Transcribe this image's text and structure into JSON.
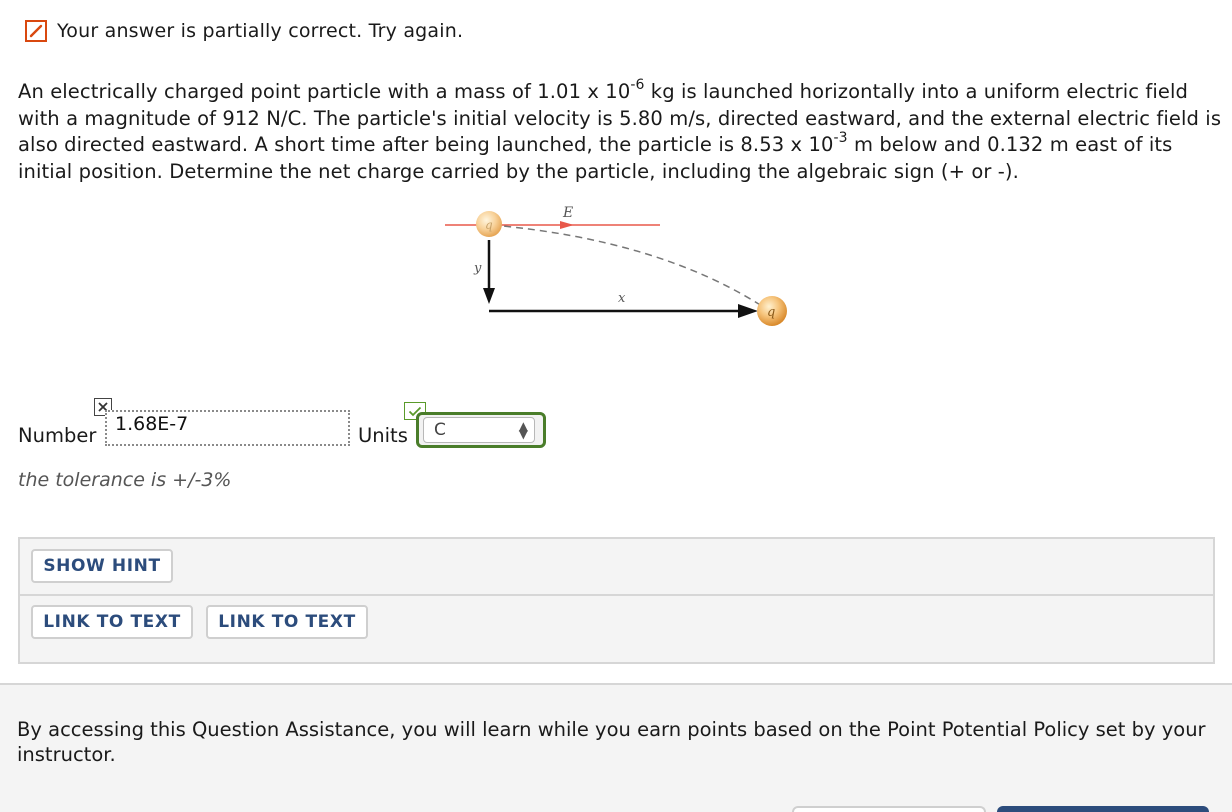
{
  "status": {
    "message": "Your answer is partially correct.  Try again."
  },
  "question": {
    "part1": "An electrically charged point particle with a mass of 1.01 x 10",
    "exp1": "-6",
    "part2": " kg is launched horizontally into a uniform electric field with a magnitude of 912 N/C. The particle's initial velocity is 5.80 m/s, directed eastward, and the external electric field is also directed eastward. A short time after being launched, the particle is 8.53 x 10",
    "exp2": "-3",
    "part3": " m below and 0.132 m east of its initial position. Determine the net charge carried by the particle, including the algebraic sign (+ or -)."
  },
  "figure": {
    "field_label": "E",
    "y_label": "y",
    "x_label": "x",
    "charge_label": "q"
  },
  "answer": {
    "number_label": "Number",
    "number_value": "1.68E-7",
    "units_label": "Units",
    "units_value": "C",
    "tolerance": "the tolerance is +/-3%"
  },
  "hints": {
    "show_hint": "SHOW HINT",
    "link_to_text_1": "LINK TO TEXT",
    "link_to_text_2": "LINK TO TEXT"
  },
  "footer": {
    "text": "By accessing this Question Assistance, you will learn while you earn points based on the Point Potential Policy set by your instructor."
  },
  "colors": {
    "accent": "#2c4c7c",
    "status_partial": "#d9480f",
    "correct": "#4a7d2a",
    "field_line": "#e8584a"
  }
}
